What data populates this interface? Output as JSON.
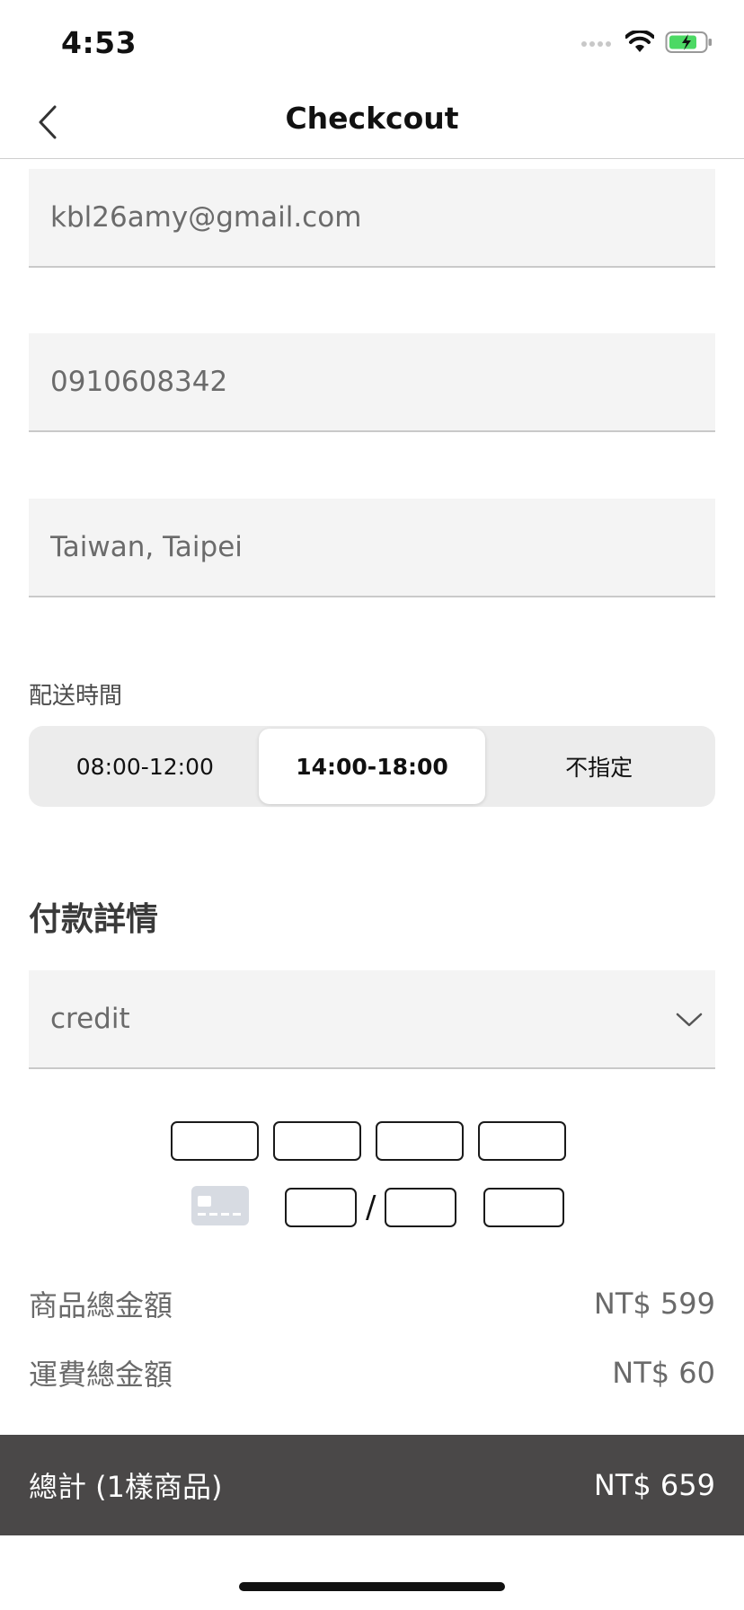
{
  "status_bar": {
    "time": "4:53",
    "icons": [
      "signal-icon",
      "wifi-icon",
      "battery-charging-icon"
    ],
    "battery_color": "#4cd964"
  },
  "nav": {
    "back_icon": "chevron-left-icon",
    "title": "Checkcout"
  },
  "form": {
    "email": "kbl26amy@gmail.com",
    "phone": "0910608342",
    "address": "Taiwan, Taipei"
  },
  "delivery": {
    "label": "配送時間",
    "options": [
      "08:00-12:00",
      "14:00-18:00",
      "不指定"
    ],
    "selected": "14:00-18:00"
  },
  "payment": {
    "heading": "付款詳情",
    "method": "credit",
    "dropdown_icon": "chevron-down-icon",
    "card_icon": "credit-card-icon",
    "expiry_separator": "/"
  },
  "summary": {
    "subtotal_label": "商品總金額",
    "subtotal_value": "NT$ 599",
    "shipping_label": "運費總金額",
    "shipping_value": "NT$ 60"
  },
  "total": {
    "label": "總計 (1樣商品)",
    "value": "NT$ 659",
    "bar_color": "#4a4848"
  }
}
